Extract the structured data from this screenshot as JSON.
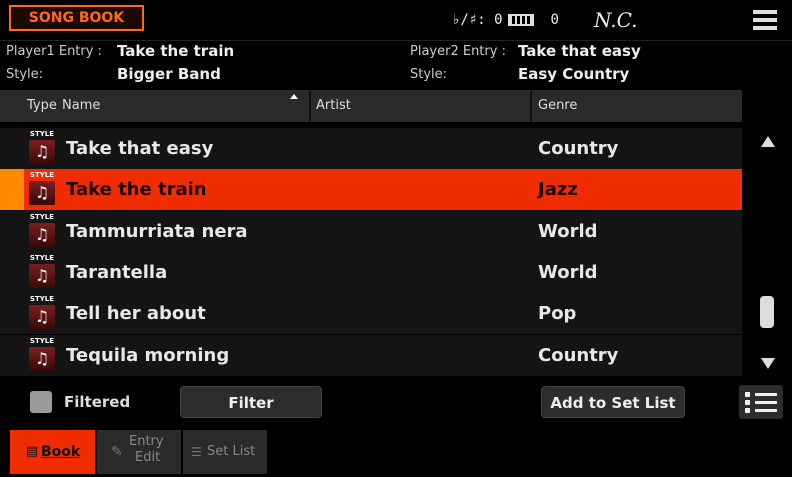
{
  "header": {
    "title": "SONG BOOK",
    "transpose_label": "♭/♯: 0",
    "keyboard_value": "0",
    "chord": "N.C."
  },
  "info": {
    "player1_label": "Player1 Entry :",
    "player1_value": "Take the train",
    "style1_label": "Style:",
    "style1_value": "Bigger Band",
    "player2_label": "Player2 Entry :",
    "player2_value": "Take that easy",
    "style2_label": "Style:",
    "style2_value": "Easy Country"
  },
  "table": {
    "columns": [
      "Type",
      "Name",
      "Artist",
      "Genre"
    ],
    "type_badge": "STYLE",
    "rows": [
      {
        "name": "Take that easy",
        "genre": "Country"
      },
      {
        "name": "Take the train",
        "genre": "Jazz"
      },
      {
        "name": "Tammurriata nera",
        "genre": "World"
      },
      {
        "name": "Tarantella",
        "genre": "World"
      },
      {
        "name": "Tell her about",
        "genre": "Pop"
      },
      {
        "name": "Tequila morning",
        "genre": "Country"
      }
    ],
    "selected_index": 1
  },
  "actions": {
    "filtered_label": "Filtered",
    "filter_button": "Filter",
    "add_to_set_list_button": "Add to Set List"
  },
  "tabs": {
    "book": "Book",
    "entry_edit_line1": "Entry",
    "entry_edit_line2": "Edit",
    "set_list": "Set List"
  },
  "colors": {
    "accent": "#f02d00",
    "title": "#ff6a1a"
  }
}
